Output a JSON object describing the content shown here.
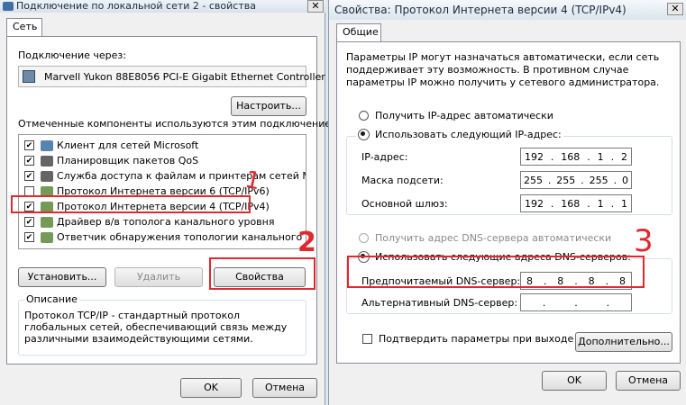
{
  "left": {
    "title": "Подключение по локальной сети 2 - свойства",
    "tab_network": "Сеть",
    "connect_via_label": "Подключение через:",
    "adapter_name": "Marvell Yukon 88E8056 PCI-E Gigabit Ethernet Controller",
    "configure_button": "Настроить...",
    "components_label": "Отмеченные компоненты используются этим подключением:",
    "components": [
      {
        "label": "Клиент для сетей Microsoft",
        "checked": true,
        "icon": "network-client-icon"
      },
      {
        "label": "Планировщик пакетов QoS",
        "checked": true,
        "icon": "qos-icon"
      },
      {
        "label": "Служба доступа к файлам и принтерам сетей Micro...",
        "checked": true,
        "icon": "file-printer-icon"
      },
      {
        "label": "Протокол Интернета версии 6 (TCP/IPv6)",
        "checked": false,
        "icon": "protocol-icon"
      },
      {
        "label": "Протокол Интернета версии 4 (TCP/IPv4)",
        "checked": true,
        "icon": "protocol-icon"
      },
      {
        "label": "Драйвер в/в тополога канального уровня",
        "checked": true,
        "icon": "protocol-icon"
      },
      {
        "label": "Ответчик обнаружения топологии канального уровня",
        "checked": true,
        "icon": "protocol-icon"
      }
    ],
    "install_button": "Установить...",
    "remove_button": "Удалить",
    "properties_button": "Свойства",
    "description_legend": "Описание",
    "description_text": "Протокол TCP/IP - стандартный протокол глобальных сетей, обеспечивающий связь между различными взаимодействующими сетями.",
    "ok_button": "OK",
    "cancel_button": "Отмена"
  },
  "right": {
    "title": "Свойства: Протокол Интернета версии 4 (TCP/IPv4)",
    "tab_general": "Общие",
    "intro_text": "Параметры IP могут назначаться автоматически, если сеть поддерживает эту возможность. В противном случае параметры IP можно получить у сетевого администратора.",
    "radio_auto_ip": "Получить IP-адрес автоматически",
    "radio_manual_ip": "Использовать следующий IP-адрес:",
    "ip_label": "IP-адрес:",
    "ip_value": [
      "192",
      "168",
      "1",
      "2"
    ],
    "mask_label": "Маска подсети:",
    "mask_value": [
      "255",
      "255",
      "255",
      "0"
    ],
    "gateway_label": "Основной шлюз:",
    "gateway_value": [
      "192",
      "168",
      "1",
      "1"
    ],
    "radio_auto_dns": "Получить адрес DNS-сервера автоматически",
    "radio_manual_dns": "Использовать следующие адреса DNS-серверов:",
    "preferred_dns_label": "Предпочитаемый DNS-сервер:",
    "preferred_dns_value": [
      "8",
      "8",
      "8",
      "8"
    ],
    "alternate_dns_label": "Альтернативный DNS-сервер:",
    "alternate_dns_value": [
      "",
      "",
      "",
      ""
    ],
    "validate_checkbox": "Подтвердить параметры при выходе",
    "advanced_button": "Дополнительно...",
    "ok_button": "OK",
    "cancel_button": "Отмена"
  },
  "annotations": {
    "one": "1",
    "two": "2",
    "three": "3"
  },
  "colors": {
    "annotation_red": "#e0292e",
    "window_bg": "#f0f0f0"
  }
}
